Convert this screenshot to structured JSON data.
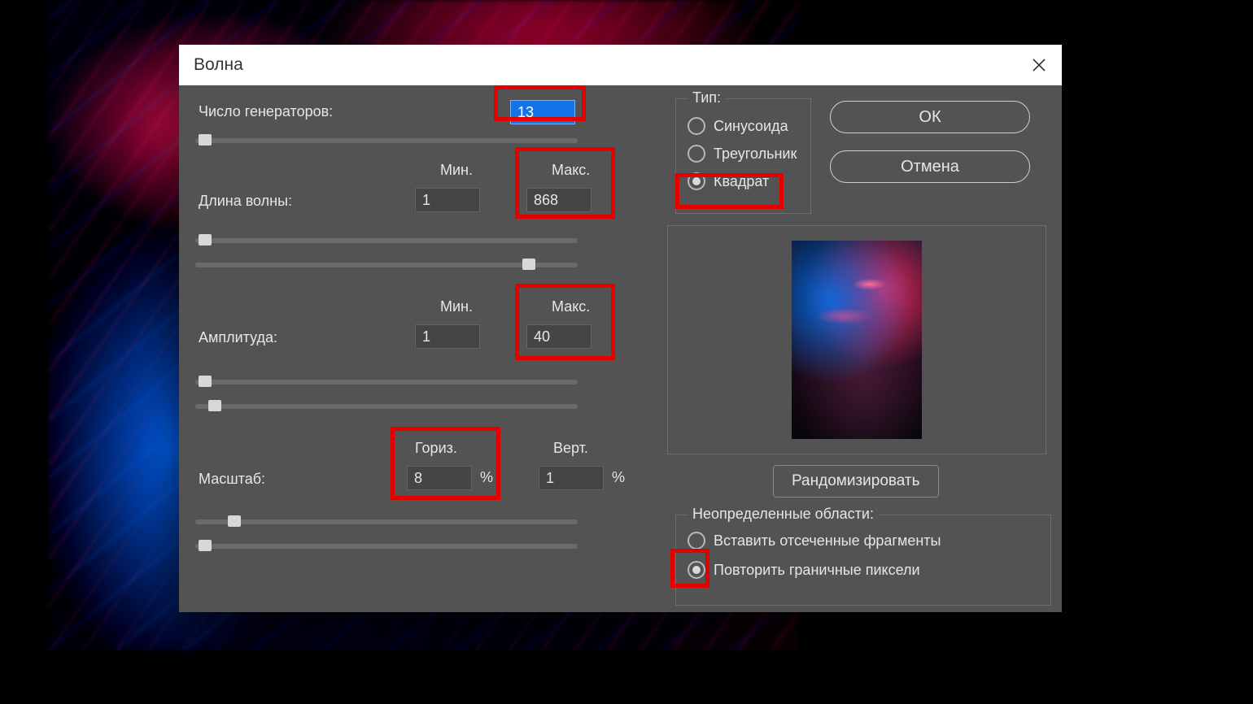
{
  "dialog": {
    "title": "Волна",
    "generators": {
      "label": "Число генераторов:",
      "value": "13"
    },
    "wavelength": {
      "label": "Длина волны:",
      "min_header": "Мин.",
      "max_header": "Макс.",
      "min": "1",
      "max": "868"
    },
    "amplitude": {
      "label": "Амплитуда:",
      "min_header": "Мин.",
      "max_header": "Макс.",
      "min": "1",
      "max": "40"
    },
    "scale": {
      "label": "Масштаб:",
      "horiz_header": "Гориз.",
      "vert_header": "Верт.",
      "horiz": "8",
      "vert": "1",
      "unit": "%"
    },
    "type": {
      "legend": "Тип:",
      "options": {
        "sine": "Синусоида",
        "triangle": "Треугольник",
        "square": "Квадрат"
      },
      "selected": "square"
    },
    "undefined_areas": {
      "legend": "Неопределенные области:",
      "options": {
        "wrap": "Вставить отсеченные фрагменты",
        "repeat": "Повторить граничные пиксели"
      },
      "selected": "repeat"
    },
    "buttons": {
      "ok": "ОК",
      "cancel": "Отмена",
      "randomize": "Рандомизировать"
    }
  }
}
